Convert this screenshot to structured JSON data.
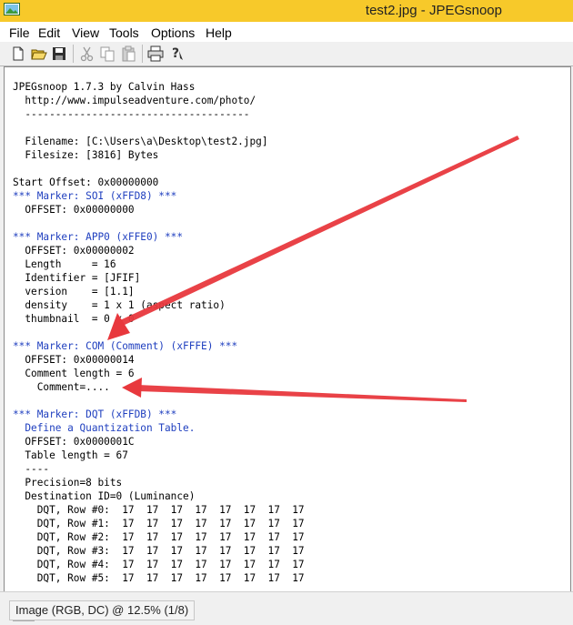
{
  "window": {
    "title": "test2.jpg - JPEGsnoop"
  },
  "menu": [
    "File",
    "Edit",
    "View",
    "Tools",
    "Options",
    "Help"
  ],
  "toolbar": {
    "buttons": [
      "new-icon",
      "open-icon",
      "save-icon",
      "cut-icon",
      "copy-icon",
      "paste-icon",
      "print-icon",
      "help-icon"
    ]
  },
  "log": {
    "lines": [
      {
        "text": "JPEGsnoop 1.7.3 by Calvin Hass",
        "color": "#000000"
      },
      {
        "text": "  http://www.impulseadventure.com/photo/",
        "color": "#000000"
      },
      {
        "text": "  -------------------------------------",
        "color": "#000000"
      },
      {
        "text": "",
        "color": "#000000"
      },
      {
        "text": "  Filename: [C:\\Users\\a\\Desktop\\test2.jpg]",
        "color": "#000000"
      },
      {
        "text": "  Filesize: [3816] Bytes",
        "color": "#000000"
      },
      {
        "text": "",
        "color": "#000000"
      },
      {
        "text": "Start Offset: 0x00000000",
        "color": "#000000"
      },
      {
        "text": "*** Marker: SOI (xFFD8) ***",
        "color": "#1f3fbf"
      },
      {
        "text": "  OFFSET: 0x00000000",
        "color": "#000000"
      },
      {
        "text": "",
        "color": "#000000"
      },
      {
        "text": "*** Marker: APP0 (xFFE0) ***",
        "color": "#1f3fbf"
      },
      {
        "text": "  OFFSET: 0x00000002",
        "color": "#000000"
      },
      {
        "text": "  Length     = 16",
        "color": "#000000"
      },
      {
        "text": "  Identifier = [JFIF]",
        "color": "#000000"
      },
      {
        "text": "  version    = [1.1]",
        "color": "#000000"
      },
      {
        "text": "  density    = 1 x 1 (aspect ratio)",
        "color": "#000000"
      },
      {
        "text": "  thumbnail  = 0 x 0",
        "color": "#000000"
      },
      {
        "text": "",
        "color": "#000000"
      },
      {
        "text": "*** Marker: COM (Comment) (xFFFE) ***",
        "color": "#1f3fbf"
      },
      {
        "text": "  OFFSET: 0x00000014",
        "color": "#000000"
      },
      {
        "text": "  Comment length = 6",
        "color": "#000000"
      },
      {
        "text": "    Comment=....",
        "color": "#000000"
      },
      {
        "text": "",
        "color": "#000000"
      },
      {
        "text": "*** Marker: DQT (xFFDB) ***",
        "color": "#1f3fbf"
      },
      {
        "text": "  Define a Quantization Table.",
        "color": "#1f3fbf"
      },
      {
        "text": "  OFFSET: 0x0000001C",
        "color": "#000000"
      },
      {
        "text": "  Table length = 67",
        "color": "#000000"
      },
      {
        "text": "  ----",
        "color": "#000000"
      },
      {
        "text": "  Precision=8 bits",
        "color": "#000000"
      },
      {
        "text": "  Destination ID=0 (Luminance)",
        "color": "#000000"
      },
      {
        "text": "    DQT, Row #0:  17  17  17  17  17  17  17  17",
        "color": "#000000"
      },
      {
        "text": "    DQT, Row #1:  17  17  17  17  17  17  17  17",
        "color": "#000000"
      },
      {
        "text": "    DQT, Row #2:  17  17  17  17  17  17  17  17",
        "color": "#000000"
      },
      {
        "text": "    DQT, Row #3:  17  17  17  17  17  17  17  17",
        "color": "#000000"
      },
      {
        "text": "    DQT, Row #4:  17  17  17  17  17  17  17  17",
        "color": "#000000"
      },
      {
        "text": "    DQT, Row #5:  17  17  17  17  17  17  17  17",
        "color": "#000000"
      }
    ]
  },
  "status": {
    "text": "Image (RGB, DC) @ 12.5% (1/8)"
  },
  "colors": {
    "titlebar": "#f7c92a",
    "marker_text": "#1f3fbf",
    "annotation_arrow": "#e8383d"
  }
}
